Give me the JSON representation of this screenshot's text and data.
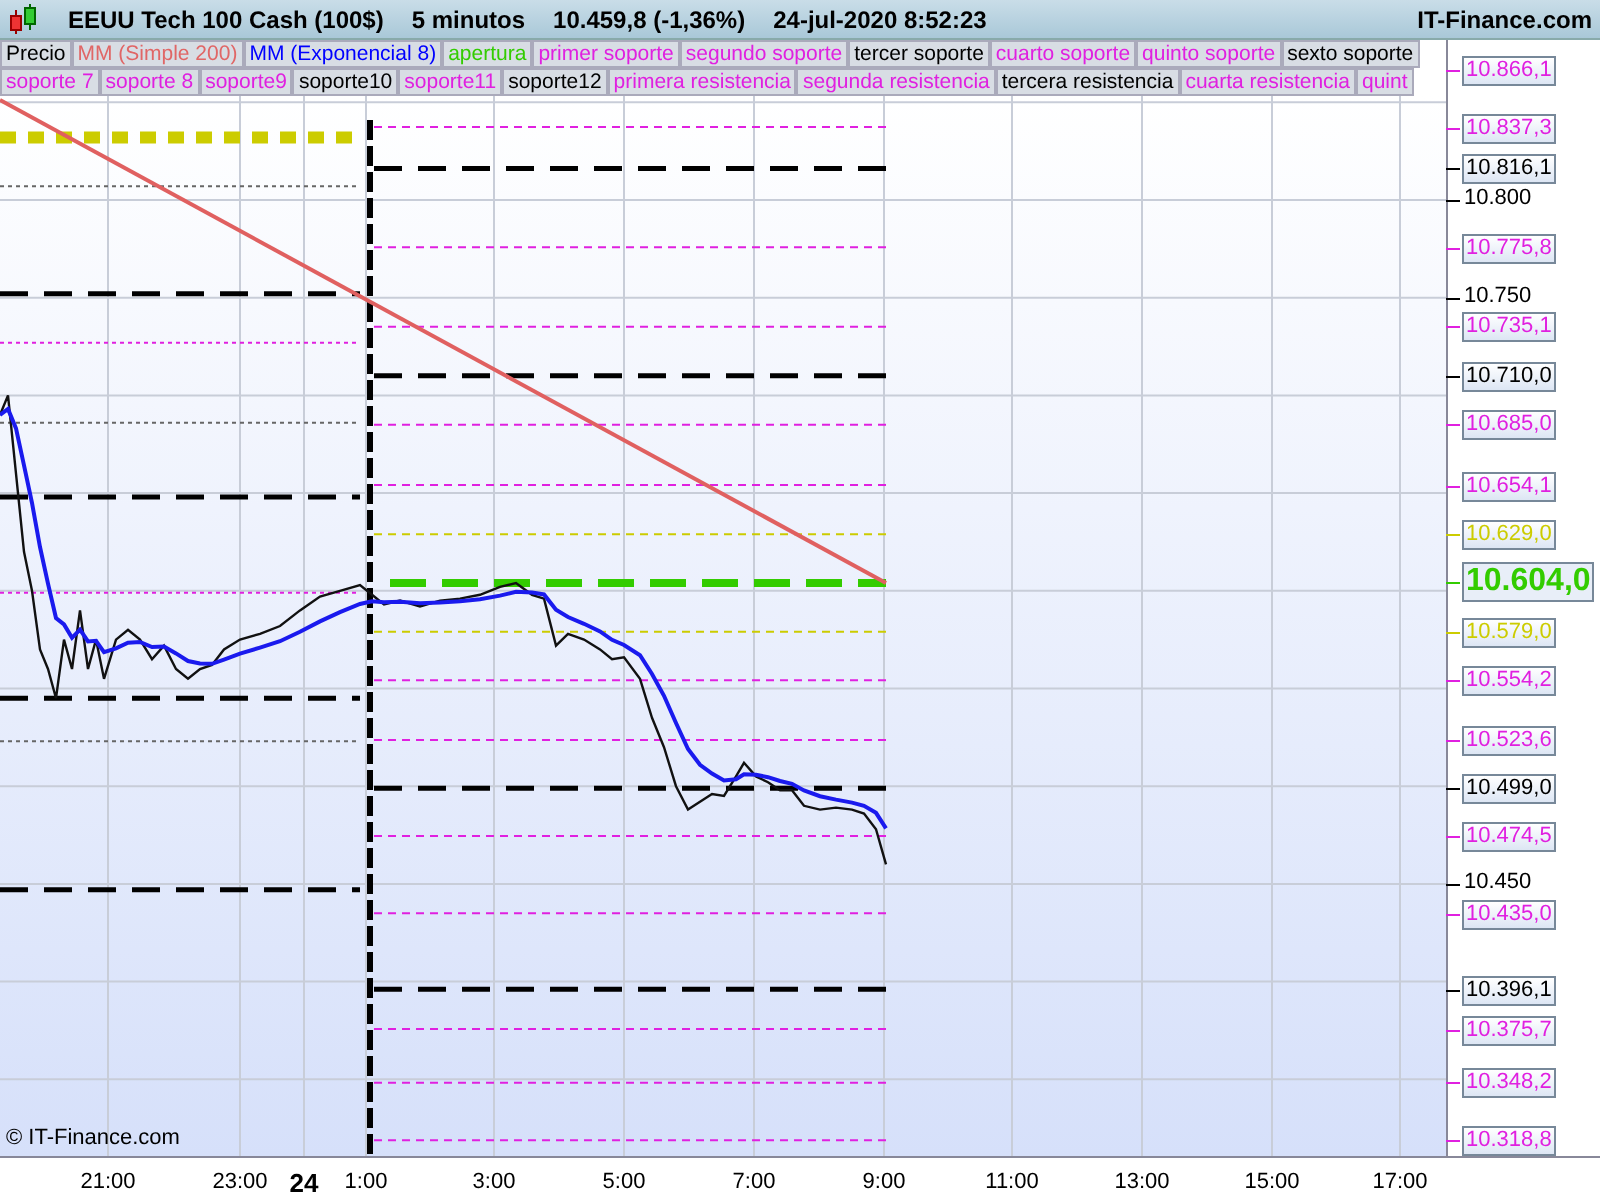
{
  "header": {
    "instrument": "EEUU Tech 100 Cash (100$)",
    "interval": "5 minutos",
    "quote": "10.459,8 (-1,36%)",
    "timestamp": "24-jul-2020 8:52:23",
    "site": "IT-Finance.com"
  },
  "legend": {
    "row_1": [
      {
        "label": "Precio",
        "color": "#000000"
      },
      {
        "label": "MM (Simple 200)",
        "color": "#e06666"
      },
      {
        "label": "MM (Exponencial 8)",
        "color": "#0000ff"
      },
      {
        "label": "apertura",
        "color": "#33cc00"
      },
      {
        "label": "primer soporte",
        "color": "#e020e0"
      },
      {
        "label": "segundo soporte",
        "color": "#e020e0"
      },
      {
        "label": "tercer soporte",
        "color": "#000000"
      },
      {
        "label": "cuarto soporte",
        "color": "#e020e0"
      },
      {
        "label": "quinto soporte",
        "color": "#e020e0"
      },
      {
        "label": "sexto soporte",
        "color": "#000000"
      }
    ],
    "row_2": [
      {
        "label": "soporte 7",
        "color": "#e020e0"
      },
      {
        "label": "soporte 8",
        "color": "#e020e0"
      },
      {
        "label": "soporte9",
        "color": "#e020e0"
      },
      {
        "label": "soporte10",
        "color": "#000000"
      },
      {
        "label": "soporte11",
        "color": "#e020e0"
      },
      {
        "label": "soporte12",
        "color": "#000000"
      },
      {
        "label": "primera resistencia",
        "color": "#e020e0"
      },
      {
        "label": "segunda resistencia",
        "color": "#e020e0"
      },
      {
        "label": "tercera resistencia",
        "color": "#000000"
      },
      {
        "label": "cuarta resistencia",
        "color": "#e020e0"
      },
      {
        "label": "quint",
        "color": "#e020e0"
      }
    ]
  },
  "price_axis": [
    {
      "text": "10.866,1",
      "color": "#e020e0",
      "kind": "fine"
    },
    {
      "text": "10.837,3",
      "color": "#e020e0",
      "kind": "fine"
    },
    {
      "text": "10.816,1",
      "color": "#000000",
      "kind": "heavy"
    },
    {
      "text": "10.800",
      "kind": "tick"
    },
    {
      "text": "10.775,8",
      "color": "#e020e0",
      "kind": "fine"
    },
    {
      "text": "10.750",
      "kind": "tick"
    },
    {
      "text": "10.735,1",
      "color": "#e020e0",
      "kind": "fine"
    },
    {
      "text": "10.710,0",
      "color": "#000000",
      "kind": "heavy"
    },
    {
      "text": "10.685,0",
      "color": "#e020e0",
      "kind": "fine"
    },
    {
      "text": "10.654,1",
      "color": "#e020e0",
      "kind": "fine"
    },
    {
      "text": "10.629,0",
      "color": "#cccc00",
      "kind": "fine"
    },
    {
      "text": "10.604,0",
      "color": "#33cc00",
      "kind": "current"
    },
    {
      "text": "10.579,0",
      "color": "#cccc00",
      "kind": "fine"
    },
    {
      "text": "10.554,2",
      "color": "#e020e0",
      "kind": "fine"
    },
    {
      "text": "10.523,6",
      "color": "#e020e0",
      "kind": "fine"
    },
    {
      "text": "10.499,0",
      "color": "#000000",
      "kind": "heavy"
    },
    {
      "text": "10.474,5",
      "color": "#e020e0",
      "kind": "fine"
    },
    {
      "text": "10.450",
      "kind": "tick"
    },
    {
      "text": "10.435,0",
      "color": "#e020e0",
      "kind": "fine"
    },
    {
      "text": "10.396,1",
      "color": "#000000",
      "kind": "heavy"
    },
    {
      "text": "10.375,7",
      "color": "#e020e0",
      "kind": "fine"
    },
    {
      "text": "10.348,2",
      "color": "#e020e0",
      "kind": "fine"
    },
    {
      "text": "10.318,8",
      "color": "#e020e0",
      "kind": "fine"
    }
  ],
  "time_axis": [
    {
      "text": "21:00",
      "kind": "time"
    },
    {
      "text": "23:00",
      "kind": "time"
    },
    {
      "text": "24",
      "kind": "day"
    },
    {
      "text": "1:00",
      "kind": "time"
    },
    {
      "text": "3:00",
      "kind": "time"
    },
    {
      "text": "5:00",
      "kind": "time"
    },
    {
      "text": "7:00",
      "kind": "time"
    },
    {
      "text": "9:00",
      "kind": "time"
    },
    {
      "text": "11:00",
      "kind": "time"
    },
    {
      "text": "13:00",
      "kind": "time"
    },
    {
      "text": "15:00",
      "kind": "time"
    },
    {
      "text": "17:00",
      "kind": "time"
    }
  ],
  "copyright": "© IT-Finance.com"
}
